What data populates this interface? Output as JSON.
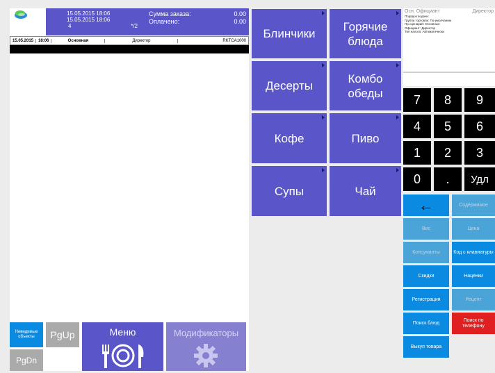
{
  "header": {
    "info_line1": "15.05.2015 18:06",
    "info_line2": "15.05.2015 18:06",
    "info_line3_left": "4",
    "info_line3_right": "*/2",
    "order_sum_label": "Сумма заказа:",
    "order_sum_value": "0.00",
    "paid_label": "Оплачено:",
    "paid_value": "0.00"
  },
  "strip": {
    "date": "15.05.2015",
    "time": "18:06",
    "hall": "Основная",
    "role": "Директор",
    "terminal": "RKTCA1000"
  },
  "bottom_left": {
    "hidden_objects": "Невидимые объекты",
    "pgup": "PgUp",
    "pgdn": "PgDn",
    "menu": "Меню",
    "modifiers": "Модификаторы"
  },
  "categories": [
    "Блинчики",
    "Горячие блюда",
    "Десерты",
    "Комбо обеды",
    "Кофе",
    "Пиво",
    "Супы",
    "Чай"
  ],
  "info_panel": {
    "title_left": "Осн. Официант",
    "title_right": "Директор",
    "lines": [
      "Порядок подачи:",
      "Группа торговли: По-умолчанию",
      "Пр.сценарий: Основные",
      "Официант: Директор",
      "Тип налога: Автоматически"
    ]
  },
  "keypad": {
    "keys": [
      "7",
      "8",
      "9",
      "4",
      "5",
      "6",
      "1",
      "2",
      "3",
      "0",
      ".",
      "Удл"
    ],
    "backspace": "←"
  },
  "functions": {
    "contents": "Содержимое",
    "weight": "Вес",
    "price": "Цена",
    "consumables": "Консуманты",
    "code_from_keyboard": "Код с клавиатуры",
    "discounts": "Скидки",
    "markups": "Наценки",
    "registration": "Регистрация",
    "recipe": "Рецепт",
    "dish_search": "Поиск блюд",
    "phone_search": "Поиск по телефону",
    "buyout": "Выкуп товара"
  },
  "colors": {
    "accent_purple": "#5a55c8",
    "function_blue": "#0a8ae0",
    "keypad_black": "#000000",
    "alert_red": "#e02020"
  }
}
